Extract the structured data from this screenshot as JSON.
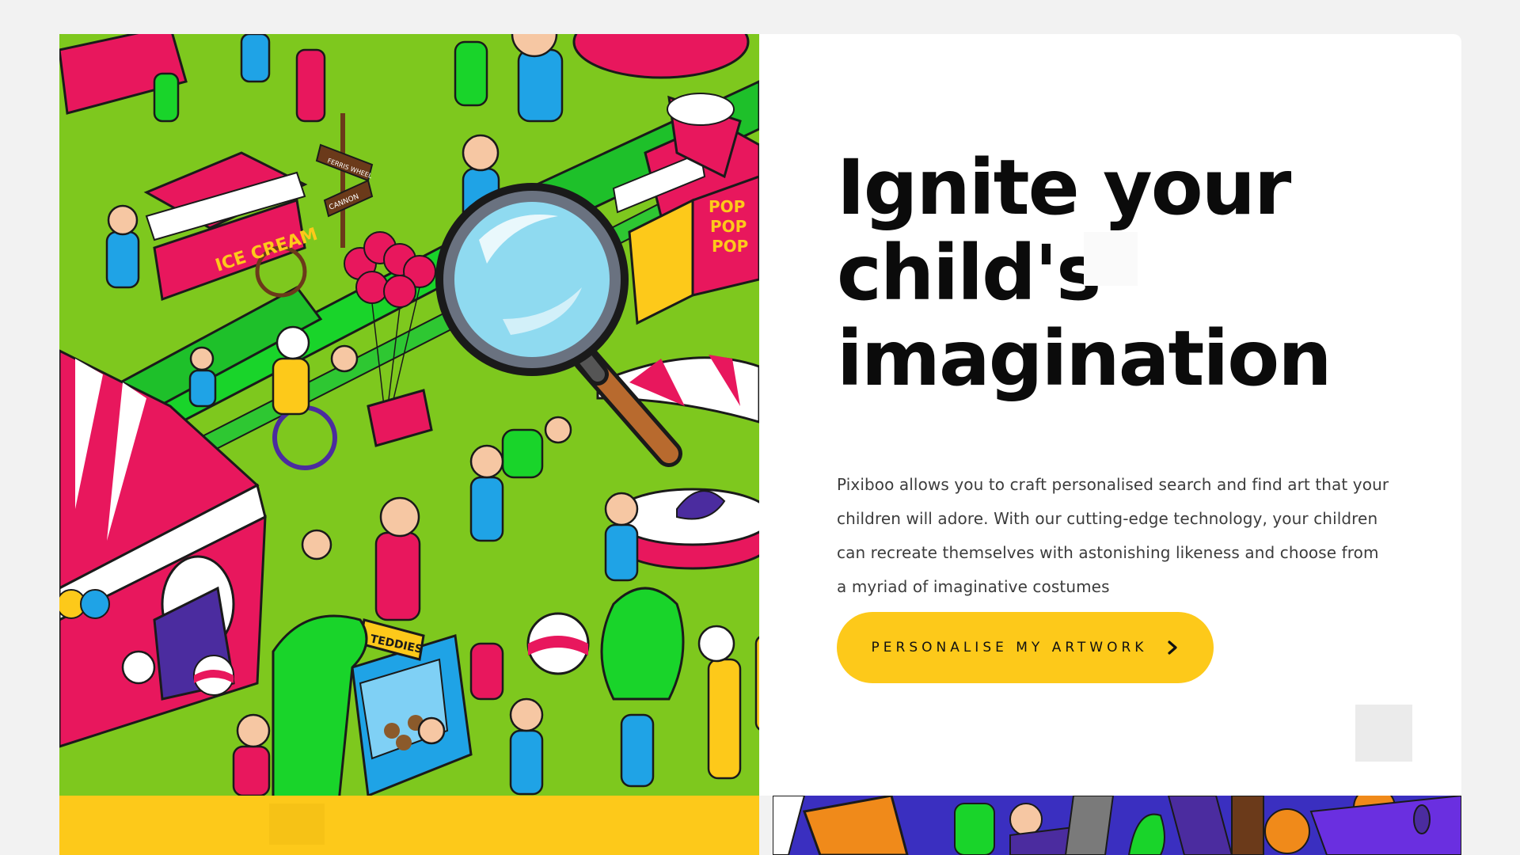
{
  "hero": {
    "headline_lines": [
      "Ignite your",
      "child's",
      "imagination"
    ],
    "description": "Pixiboo allows you to craft personalised search and find art that your children will adore. With our cutting-edge technology, your children can recreate themselves with astonishing likeness and choose from a myriad of imaginative costumes",
    "cta_label": "PERSONALISE MY ARTWORK",
    "cta_icon": "chevron-right-icon"
  },
  "illustration": {
    "signs": [
      "FERRIS WHEEL",
      "CANNON",
      "ICE CREAM",
      "POP",
      "POP",
      "POP",
      "TEDDIES"
    ]
  },
  "colors": {
    "background": "#f2f2f2",
    "card": "#ffffff",
    "accent_yellow": "#fdc91a",
    "grass": "#7ec81e",
    "pink": "#e8175d",
    "bright_green": "#19d42a",
    "blue": "#1fa3e6",
    "purple": "#4b2c9f"
  }
}
